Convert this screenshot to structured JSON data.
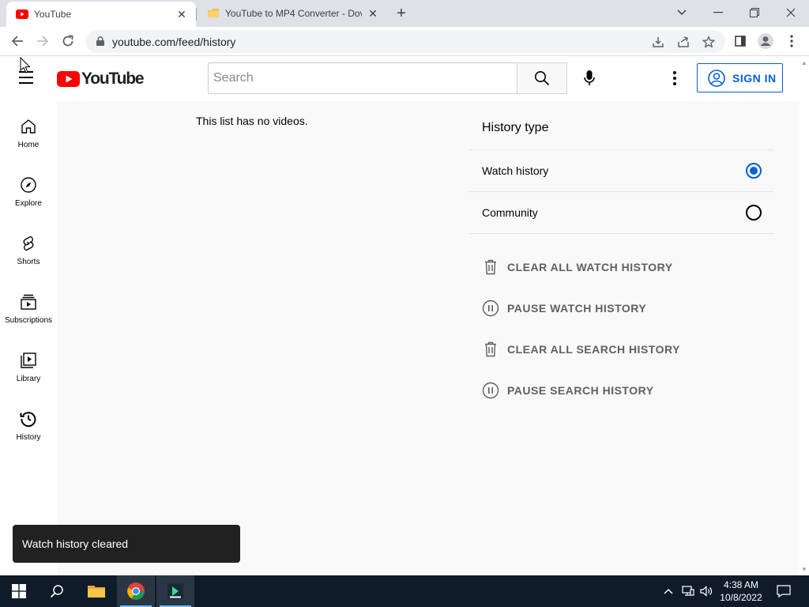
{
  "browser": {
    "tabs": [
      {
        "title": "YouTube",
        "active": true
      },
      {
        "title": "YouTube to MP4 Converter - Dov",
        "active": false
      }
    ],
    "new_tab_label": "+",
    "url": "youtube.com/feed/history"
  },
  "youtube": {
    "logo_text": "YouTube",
    "search_placeholder": "Search",
    "signin_label": "SIGN IN",
    "guide": [
      {
        "label": "Home",
        "icon": "home-icon"
      },
      {
        "label": "Explore",
        "icon": "compass-icon"
      },
      {
        "label": "Shorts",
        "icon": "shorts-icon"
      },
      {
        "label": "Subscriptions",
        "icon": "subscriptions-icon"
      },
      {
        "label": "Library",
        "icon": "library-icon"
      },
      {
        "label": "History",
        "icon": "history-icon"
      }
    ],
    "empty_message": "This list has no videos.",
    "history_panel": {
      "title": "History type",
      "options": [
        {
          "label": "Watch history",
          "selected": true
        },
        {
          "label": "Community",
          "selected": false
        }
      ],
      "actions": [
        {
          "label": "CLEAR ALL WATCH HISTORY",
          "icon": "trash-icon"
        },
        {
          "label": "PAUSE WATCH HISTORY",
          "icon": "pause-icon"
        },
        {
          "label": "CLEAR ALL SEARCH HISTORY",
          "icon": "trash-icon"
        },
        {
          "label": "PAUSE SEARCH HISTORY",
          "icon": "pause-icon"
        }
      ]
    },
    "toast": "Watch history cleared"
  },
  "taskbar": {
    "time": "4:38 AM",
    "date": "10/8/2022"
  },
  "colors": {
    "accent_blue": "#065fd4",
    "youtube_red": "#ff0000",
    "taskbar_bg": "#101b2a"
  }
}
